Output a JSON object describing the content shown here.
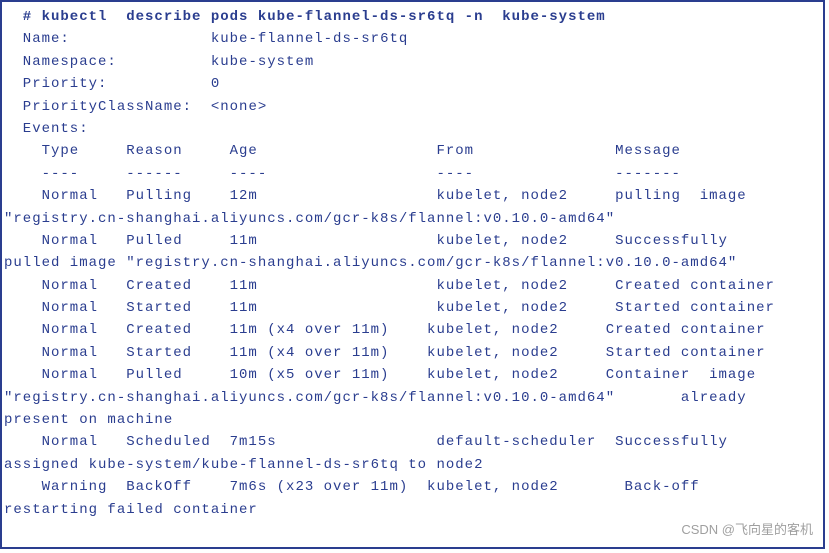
{
  "command": "  # kubectl  describe pods kube-flannel-ds-sr6tq -n  kube-system",
  "name_label": "  Name:               ",
  "name_value": "kube-flannel-ds-sr6tq",
  "namespace_label": "  Namespace:          ",
  "namespace_value": "kube-system",
  "priority_label": "  Priority:           ",
  "priority_value": "0",
  "priorityclass_label": "  PriorityClassName:  ",
  "priorityclass_value": "<none>",
  "events_label": "  Events:",
  "events_header": "    Type     Reason     Age                   From               Message",
  "events_divider": "    ----     ------     ----                  ----               -------",
  "events_lines": [
    "    Normal   Pulling    12m                   kubelet, node2     pulling  image",
    "\"registry.cn-shanghai.aliyuncs.com/gcr-k8s/flannel:v0.10.0-amd64\"",
    "    Normal   Pulled     11m                   kubelet, node2     Successfully",
    "pulled image \"registry.cn-shanghai.aliyuncs.com/gcr-k8s/flannel:v0.10.0-amd64\"",
    "    Normal   Created    11m                   kubelet, node2     Created container",
    "    Normal   Started    11m                   kubelet, node2     Started container",
    "    Normal   Created    11m (x4 over 11m)    kubelet, node2     Created container",
    "    Normal   Started    11m (x4 over 11m)    kubelet, node2     Started container",
    "    Normal   Pulled     10m (x5 over 11m)    kubelet, node2     Container  image",
    "\"registry.cn-shanghai.aliyuncs.com/gcr-k8s/flannel:v0.10.0-amd64\"       already",
    "present on machine",
    "    Normal   Scheduled  7m15s                 default-scheduler  Successfully",
    "assigned kube-system/kube-flannel-ds-sr6tq to node2",
    "    Warning  BackOff    7m6s (x23 over 11m)  kubelet, node2       Back-off",
    "restarting failed container"
  ],
  "watermark": "CSDN @飞向星的客机"
}
